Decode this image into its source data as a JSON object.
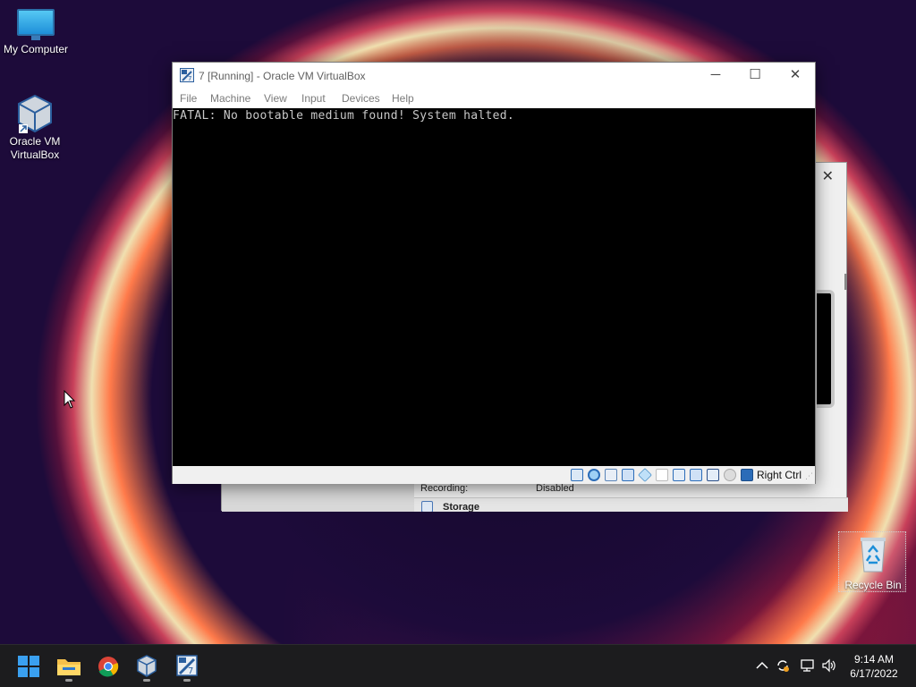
{
  "desktop": {
    "icons": [
      {
        "label": "My Computer"
      },
      {
        "label": "Oracle VM VirtualBox"
      },
      {
        "label": "Recycle Bin"
      }
    ]
  },
  "background_window": {
    "recording_label": "Recording:",
    "recording_value": "Disabled",
    "storage_label": "Storage"
  },
  "vm_window": {
    "title": "7 [Running] - Oracle VM VirtualBox",
    "menu": [
      "File",
      "Machine",
      "View",
      "Input",
      "Devices",
      "Help"
    ],
    "console_text": "FATAL: No bootable medium found! System halted.",
    "status": {
      "host_key": "Right Ctrl",
      "indicator_icons": [
        "hard-disk-icon",
        "optical-drive-icon",
        "audio-icon",
        "network-icon",
        "usb-icon",
        "shared-folders-icon",
        "display-icon",
        "recording-icon",
        "cpu-icon",
        "mouse-integration-icon",
        "keyboard-icon"
      ]
    }
  },
  "taskbar": {
    "apps": [
      "start-icon",
      "file-explorer-icon",
      "chrome-icon",
      "virtualbox-icon",
      "virtualbox-vm-icon"
    ],
    "tray": [
      "chevron-up-icon",
      "sync-icon",
      "network-icon",
      "volume-icon"
    ],
    "time": "9:14 AM",
    "date": "6/17/2022"
  }
}
